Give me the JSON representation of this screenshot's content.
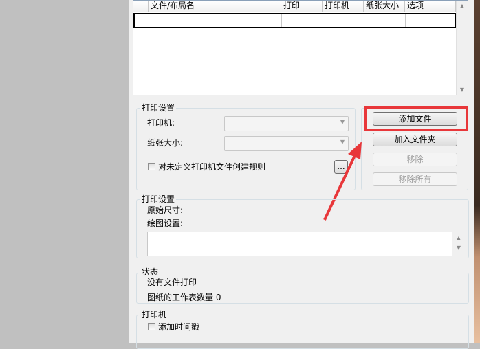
{
  "file_table": {
    "columns": [
      "",
      "文件/布局名",
      "打印",
      "打印机",
      "纸张大小",
      "选项"
    ],
    "rows": [
      [
        "",
        "",
        "",
        "",
        "",
        ""
      ]
    ]
  },
  "print_settings_group": {
    "title": "打印设置",
    "printer_label": "打印机:",
    "printer_value": "",
    "paper_label": "纸张大小:",
    "paper_value": "",
    "rule_checkbox_label": "对未定义打印机文件创建规则",
    "rule_checkbox_checked": false,
    "browse_button": "..."
  },
  "buttons": {
    "add_file": "添加文件",
    "add_folder": "加入文件夹",
    "remove": "移除",
    "remove_all": "移除所有"
  },
  "plot_settings_group": {
    "title": "打印设置",
    "original_size_label": "原始尺寸:",
    "plot_settings_label": "绘图设置:",
    "plot_settings_value": ""
  },
  "status_group": {
    "title": "状态",
    "message": "没有文件打印",
    "sheet_count_text": "图纸的工作表数量 0"
  },
  "printer_group": {
    "title": "打印机",
    "timestamp_label": "添加时间戳",
    "timestamp_checked": false
  },
  "colors": {
    "highlight": "#e8373a"
  }
}
